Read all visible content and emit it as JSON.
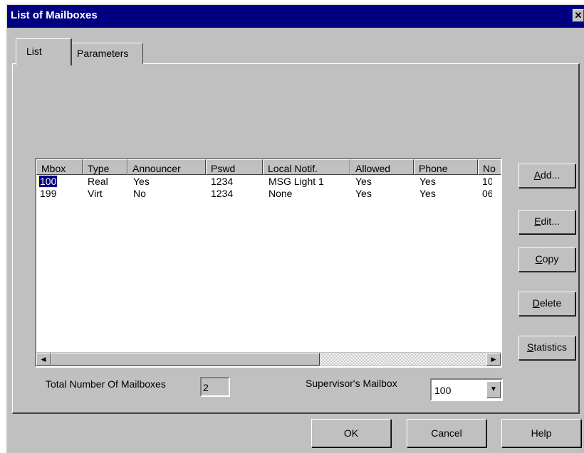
{
  "window": {
    "title": "List of Mailboxes",
    "close_glyph": "✕"
  },
  "tabs": [
    {
      "label": "List"
    },
    {
      "label": "Parameters"
    }
  ],
  "list": {
    "columns": [
      "Mbox",
      "Type",
      "Announcer",
      "Pswd",
      "Local Notif.",
      "Allowed",
      "Phone",
      "No"
    ],
    "rows": [
      [
        "100",
        "Real",
        "Yes",
        "1234",
        "MSG Light 1",
        "Yes",
        "Yes",
        "10"
      ],
      [
        "199",
        "Virt",
        "No",
        "1234",
        "None",
        "Yes",
        "Yes",
        "06"
      ]
    ],
    "selected_row": 0
  },
  "side_buttons": {
    "add": {
      "u": "A",
      "rest": "dd..."
    },
    "edit": {
      "u": "E",
      "rest": "dit..."
    },
    "copy": {
      "u": "C",
      "rest": "opy"
    },
    "delete": {
      "u": "D",
      "rest": "elete"
    },
    "statistics": {
      "u": "S",
      "rest": "tatistics"
    }
  },
  "footer": {
    "total_label": "Total Number Of Mailboxes",
    "total_value": "2",
    "supervisor_label": "Supervisor's Mailbox",
    "supervisor_value": "100"
  },
  "dialog_buttons": {
    "ok": "OK",
    "cancel": "Cancel",
    "help": "Help"
  },
  "icons": {
    "close": "close-icon",
    "scroll_left": "arrow-left-icon",
    "scroll_right": "arrow-right-icon",
    "dropdown": "chevron-down-icon"
  },
  "colors": {
    "titlebar": "#000080",
    "face": "#c0c0c0",
    "selection": "#000080"
  }
}
